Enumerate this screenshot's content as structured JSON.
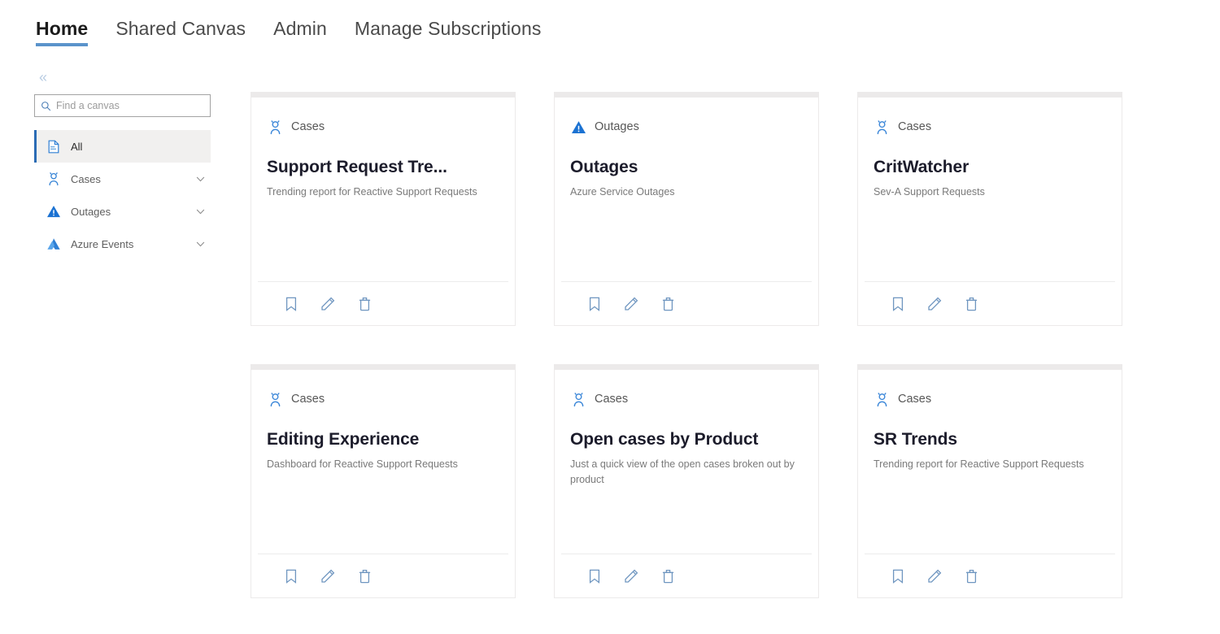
{
  "nav": {
    "tabs": [
      {
        "label": "Home",
        "active": true
      },
      {
        "label": "Shared Canvas",
        "active": false
      },
      {
        "label": "Admin",
        "active": false
      },
      {
        "label": "Manage Subscriptions",
        "active": false
      }
    ]
  },
  "sidebar": {
    "collapse_glyph": "«",
    "search": {
      "value": "",
      "placeholder": "Find a canvas",
      "icon": "search-icon"
    },
    "items": [
      {
        "label": "All",
        "icon": "page-icon",
        "selected": true,
        "expandable": false
      },
      {
        "label": "Cases",
        "icon": "person-icon",
        "selected": false,
        "expandable": true
      },
      {
        "label": "Outages",
        "icon": "warning-triangle-icon",
        "selected": false,
        "expandable": true
      },
      {
        "label": "Azure Events",
        "icon": "azure-icon",
        "selected": false,
        "expandable": true
      }
    ],
    "chevron_glyph": "∨"
  },
  "cards": [
    {
      "category": "Cases",
      "category_icon": "person-icon",
      "title": "Support Request Tre...",
      "description": "Trending report for Reactive Support Requests",
      "actions": [
        "bookmark-icon",
        "edit-icon",
        "delete-icon"
      ]
    },
    {
      "category": "Outages",
      "category_icon": "warning-triangle-icon",
      "title": "Outages",
      "description": "Azure Service Outages",
      "actions": [
        "bookmark-icon",
        "edit-icon",
        "delete-icon"
      ]
    },
    {
      "category": "Cases",
      "category_icon": "person-icon",
      "title": "CritWatcher",
      "description": "Sev-A Support Requests",
      "actions": [
        "bookmark-icon",
        "edit-icon",
        "delete-icon"
      ]
    },
    {
      "category": "Cases",
      "category_icon": "person-icon",
      "title": "Editing Experience",
      "description": "Dashboard for Reactive Support Requests",
      "actions": [
        "bookmark-icon",
        "edit-icon",
        "delete-icon"
      ]
    },
    {
      "category": "Cases",
      "category_icon": "person-icon",
      "title": "Open cases by Product",
      "description": "Just a quick view of the open cases broken out by product",
      "actions": [
        "bookmark-icon",
        "edit-icon",
        "delete-icon"
      ]
    },
    {
      "category": "Cases",
      "category_icon": "person-icon",
      "title": "SR Trends",
      "description": "Trending report for Reactive Support Requests",
      "actions": [
        "bookmark-icon",
        "edit-icon",
        "delete-icon"
      ]
    }
  ],
  "colors": {
    "accent_blue": "#5a93cb",
    "icon_blue": "#2f7fd4",
    "selected_bar": "#2b6cb5",
    "action_icon": "#6f96c0",
    "card_band": "#eceaea",
    "title": "#1c1c2b",
    "muted_text": "#7a7a7a"
  }
}
